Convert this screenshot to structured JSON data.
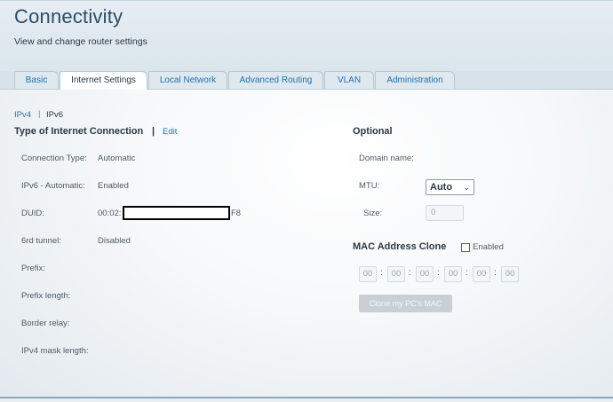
{
  "header": {
    "title": "Connectivity",
    "subtitle": "View and change router settings"
  },
  "tabs": [
    {
      "label": "Basic",
      "active": false
    },
    {
      "label": "Internet Settings",
      "active": true
    },
    {
      "label": "Local Network",
      "active": false
    },
    {
      "label": "Advanced Routing",
      "active": false
    },
    {
      "label": "VLAN",
      "active": false
    },
    {
      "label": "Administration",
      "active": false
    }
  ],
  "subtabs": {
    "ipv4": "IPv4",
    "separator": "|",
    "ipv6": "IPv6"
  },
  "connection": {
    "title": "Type of Internet Connection",
    "separator": "|",
    "edit": "Edit",
    "fields": [
      {
        "label": "Connection Type:",
        "value": "Automatic"
      },
      {
        "label": "IPv6 - Automatic:",
        "value": "Enabled"
      },
      {
        "label": "DUID:",
        "value": "00:02:",
        "value_suffix": "F8"
      },
      {
        "label": "6rd tunnel:",
        "value": "Disabled"
      },
      {
        "label": "Prefix:",
        "value": ""
      },
      {
        "label": "Prefix length:",
        "value": ""
      },
      {
        "label": "Border relay:",
        "value": ""
      },
      {
        "label": "IPv4 mask length:",
        "value": ""
      }
    ]
  },
  "optional": {
    "title": "Optional",
    "domain_label": "Domain name:",
    "mtu_label": "MTU:",
    "mtu_value": "Auto",
    "size_label": "Size:",
    "size_value": "0"
  },
  "mac_clone": {
    "title": "MAC Address Clone",
    "enabled_label": "Enabled",
    "enabled": false,
    "octets": [
      "00",
      "00",
      "00",
      "00",
      "00",
      "00"
    ],
    "separator": ":",
    "button": "Clone my PC's MAC"
  },
  "colors": {
    "link": "#1f73b0",
    "title": "#2d4c66",
    "text": "#4d5a64"
  }
}
